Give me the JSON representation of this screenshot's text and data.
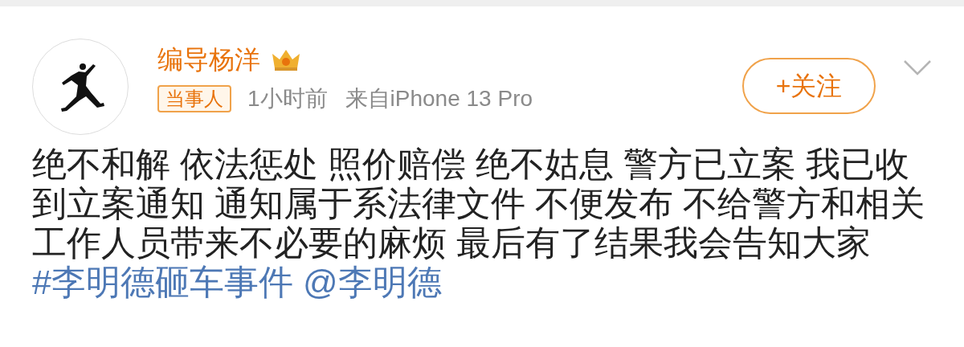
{
  "author": {
    "name": "编导杨洋",
    "tag": "当事人",
    "time": "1小时前",
    "source": "来自iPhone 13 Pro"
  },
  "follow_button": {
    "label": "+关注"
  },
  "body": {
    "text": "绝不和解 依法惩处 照价赔偿 绝不姑息 警方已立案 我已收到立案通知 通知属于系法律文件 不便发布 不给警方和相关工作人员带来不必要的麻烦 最后有了结果我会告知大家 ",
    "topic": "#李明德砸车事件",
    "mention": "@李明德"
  }
}
